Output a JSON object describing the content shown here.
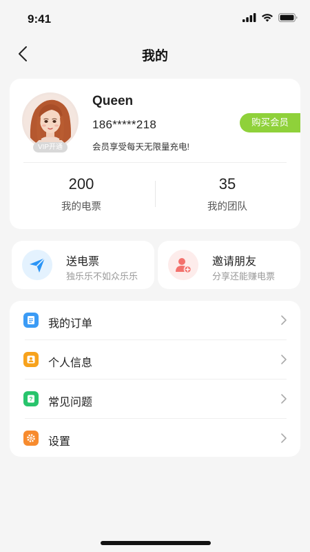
{
  "status_bar": {
    "time": "9:41"
  },
  "nav": {
    "title": "我的",
    "back_icon": "chevron-left"
  },
  "profile": {
    "name": "Queen",
    "phone": "186*****218",
    "description": "会员享受每天无限量充电!",
    "vip_tag": "VIP开通",
    "buy_button": "购买会员",
    "stats": [
      {
        "value": "200",
        "label": "我的电票"
      },
      {
        "value": "35",
        "label": "我的团队"
      }
    ]
  },
  "actions": [
    {
      "title": "送电票",
      "subtitle": "独乐乐不如众乐乐",
      "icon": "paper-plane",
      "color": "#2b95f6"
    },
    {
      "title": "邀请朋友",
      "subtitle": "分享还能赚电票",
      "icon": "add-user",
      "color": "#f3716d"
    }
  ],
  "menu": [
    {
      "label": "我的订单",
      "icon": "document",
      "color": "#3b9bf5"
    },
    {
      "label": "个人信息",
      "icon": "person",
      "color": "#f7a21c"
    },
    {
      "label": "常见问题",
      "icon": "question",
      "color": "#28c46c"
    },
    {
      "label": "设置",
      "icon": "gear",
      "color": "#f78b2e"
    }
  ],
  "colors": {
    "accent_green": "#8fd13a",
    "background": "#f5f5f5"
  }
}
